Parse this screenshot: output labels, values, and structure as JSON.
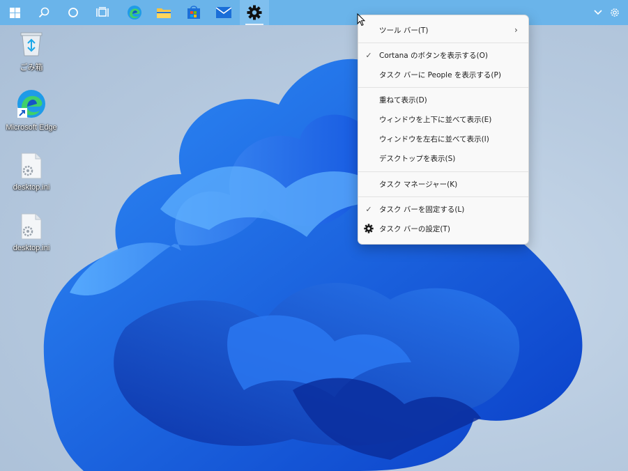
{
  "desktop": {
    "icons": [
      {
        "label": "ごみ箱"
      },
      {
        "label": "Microsoft Edge"
      },
      {
        "label": "desktop.ini"
      },
      {
        "label": "desktop.ini"
      }
    ]
  },
  "taskbar": {
    "pinned": [
      "windows-start",
      "search",
      "cortana",
      "task-view",
      "edge",
      "file-explorer",
      "store",
      "mail",
      "settings"
    ]
  },
  "context_menu": {
    "items": [
      {
        "label": "ツール バー(T)",
        "check": false,
        "submenu": true
      },
      {
        "label": "Cortana のボタンを表示する(O)",
        "check": true
      },
      {
        "label": "タスク バーに People を表示する(P)",
        "check": false
      },
      {
        "label": "重ねて表示(D)",
        "check": false
      },
      {
        "label": "ウィンドウを上下に並べて表示(E)",
        "check": false
      },
      {
        "label": "ウィンドウを左右に並べて表示(I)",
        "check": false
      },
      {
        "label": "デスクトップを表示(S)",
        "check": false
      },
      {
        "label": "タスク マネージャー(K)",
        "check": false
      },
      {
        "label": "タスク バーを固定する(L)",
        "check": true
      },
      {
        "label": "タスク バーの設定(T)",
        "icon": "gear-icon"
      }
    ],
    "check_glyph": "✓",
    "submenu_glyph": "›"
  }
}
